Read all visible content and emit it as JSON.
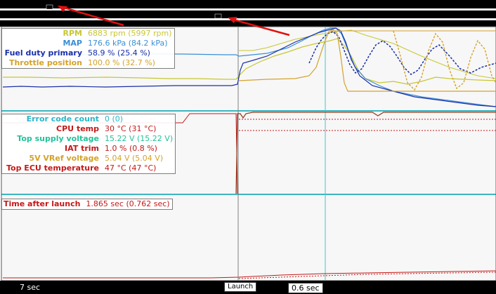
{
  "panel1": {
    "rows": [
      {
        "name": "RPM",
        "value": "6883 rpm (5997 rpm)",
        "color": "#c7c733"
      },
      {
        "name": "MAP",
        "value": "176.6 kPa (84.2 kPa)",
        "color": "#3a8fd6"
      },
      {
        "name": "Fuel duty primary",
        "value": "58.9 % (25.4 %)",
        "color": "#1a2fa8"
      },
      {
        "name": "Throttle position",
        "value": "100.0 % (32.7 %)",
        "color": "#d4a22a"
      }
    ]
  },
  "panel2": {
    "rows": [
      {
        "name": "Error code count",
        "value": "0 (0)",
        "color": "#29b6c8"
      },
      {
        "name": "CPU temp",
        "value": "30 °C (31 °C)",
        "color": "#c41818"
      },
      {
        "name": "Top supply voltage",
        "value": "15.22 V (15.22 V)",
        "color": "#22c29a"
      },
      {
        "name": "IAT trim",
        "value": "1.0 % (0.8 %)",
        "color": "#c41818"
      },
      {
        "name": "5V VRef voltage",
        "value": "5.04 V (5.04 V)",
        "color": "#d4a22a"
      },
      {
        "name": "Top ECU temperature",
        "value": "47 °C (47 °C)",
        "color": "#c41818"
      }
    ]
  },
  "panel3": {
    "rows": [
      {
        "name": "Time after launch",
        "value": "1.865 sec (0.762 sec)",
        "color": "#c41818"
      }
    ]
  },
  "markers": {
    "launch": "Launch",
    "cursor": "0.6 sec",
    "left_time": "7 sec"
  },
  "colors": {
    "background": "#ffffff",
    "panel_fill": "#f7f7f7",
    "frame": "#000000",
    "divider": "#3cb6c0",
    "annotation_arrow": "#e11010"
  }
}
